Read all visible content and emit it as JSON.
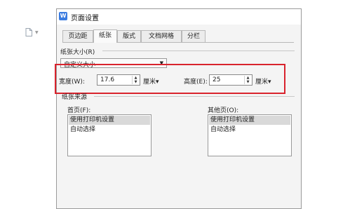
{
  "dialog": {
    "title": "页面设置",
    "app_icon_letter": "W",
    "tabs": [
      {
        "label": "页边距"
      },
      {
        "label": "纸张"
      },
      {
        "label": "版式"
      },
      {
        "label": "文档网格"
      },
      {
        "label": "分栏"
      }
    ],
    "active_tab": "纸张"
  },
  "paper_size": {
    "label": "纸张大小(R)",
    "selected": "自定义大小",
    "width": {
      "label": "宽度(W):",
      "value": "17.6",
      "unit": "厘米▾"
    },
    "height": {
      "label": "高度(E):",
      "value": "25",
      "unit": "厘米▾"
    }
  },
  "paper_source": {
    "label": "纸张来源",
    "first_page": {
      "label": "首页(F):",
      "items": [
        "使用打印机设置",
        "自动选择"
      ],
      "selected": "使用打印机设置"
    },
    "other_pages": {
      "label": "其他页(O):",
      "items": [
        "使用打印机设置",
        "自动选择"
      ],
      "selected": "使用打印机设置"
    }
  },
  "colors": {
    "highlight": "#d9232d",
    "app_icon": "#3a7be0"
  }
}
